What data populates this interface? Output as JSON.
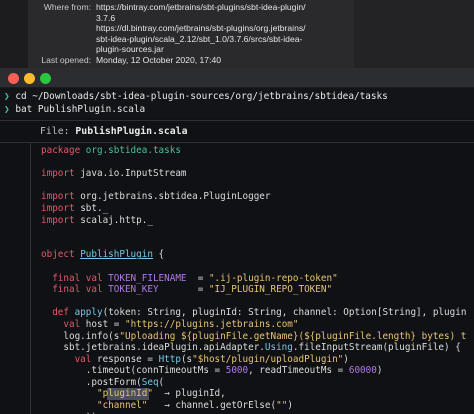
{
  "info_panel": {
    "rows": [
      {
        "key": "Where from:",
        "values": [
          "https://bintray.com/jetbrains/sbt-plugins/sbt-idea-plugin/",
          "3.7.6",
          "https://dl.bintray.com/jetbrains/sbt-plugins/org.jetbrains/",
          "sbt-idea-plugin/scala_2.12/sbt_1.0/3.7.6/srcs/sbt-idea-",
          "plugin-sources.jar"
        ]
      },
      {
        "key": "Last opened:",
        "values": [
          "Monday, 12 October 2020, 17:40"
        ]
      }
    ]
  },
  "terminal": {
    "prompt_symbol": "❯",
    "commands": [
      "cd ~/Downloads/sbt-idea-plugin-sources/org/jetbrains/sbtidea/tasks",
      "bat PublishPlugin.scala"
    ],
    "file_header_label": "File:",
    "file_name": "PublishPlugin.scala"
  },
  "code_lines": [
    [
      {
        "t": "package ",
        "c": "kw"
      },
      {
        "t": "org.sbtidea.tasks",
        "c": "pk"
      }
    ],
    [],
    [
      {
        "t": "import ",
        "c": "kw"
      },
      {
        "t": "java.io.InputStream",
        "c": ""
      }
    ],
    [],
    [
      {
        "t": "import ",
        "c": "kw"
      },
      {
        "t": "org.jetbrains.sbtidea.PluginLogger",
        "c": ""
      }
    ],
    [
      {
        "t": "import ",
        "c": "kw"
      },
      {
        "t": "sbt._",
        "c": ""
      }
    ],
    [
      {
        "t": "import ",
        "c": "kw"
      },
      {
        "t": "scalaj.http._",
        "c": ""
      }
    ],
    [],
    [],
    [
      {
        "t": "object ",
        "c": "kw"
      },
      {
        "t": "PublishPlugin",
        "c": "ty ul"
      },
      {
        "t": " {",
        "c": ""
      }
    ],
    [],
    [
      {
        "t": "  final val ",
        "c": "kw"
      },
      {
        "t": "TOKEN_FILENAME",
        "c": "cst"
      },
      {
        "t": "  = ",
        "c": ""
      },
      {
        "t": "\".ij-plugin-repo-token\"",
        "c": "str"
      }
    ],
    [
      {
        "t": "  final val ",
        "c": "kw"
      },
      {
        "t": "TOKEN_KEY",
        "c": "cst"
      },
      {
        "t": "       = ",
        "c": ""
      },
      {
        "t": "\"IJ_PLUGIN_REPO_TOKEN\"",
        "c": "str"
      }
    ],
    [],
    [
      {
        "t": "  def ",
        "c": "kw"
      },
      {
        "t": "apply",
        "c": "ty"
      },
      {
        "t": "(token: String, pluginId: String, channel: Option[String], plugin",
        "c": ""
      }
    ],
    [
      {
        "t": "    val ",
        "c": "kw"
      },
      {
        "t": "host = ",
        "c": ""
      },
      {
        "t": "\"https://plugins.jetbrains.com\"",
        "c": "str"
      }
    ],
    [
      {
        "t": "    log.info(s",
        "c": ""
      },
      {
        "t": "\"Uploading ${pluginFile.getName}(${pluginFile.length} bytes) t",
        "c": "str"
      }
    ],
    [
      {
        "t": "    sbt.jetbrains.ideaPlugin.apiAdapter.",
        "c": ""
      },
      {
        "t": "Using",
        "c": "ty"
      },
      {
        "t": ".fileInputStream(pluginFile) {",
        "c": ""
      }
    ],
    [
      {
        "t": "      val ",
        "c": "kw"
      },
      {
        "t": "response = ",
        "c": ""
      },
      {
        "t": "Http",
        "c": "ty"
      },
      {
        "t": "(s",
        "c": ""
      },
      {
        "t": "\"$host/plugin/uploadPlugin\"",
        "c": "str"
      },
      {
        "t": ")",
        "c": ""
      }
    ],
    [
      {
        "t": "        .timeout(connTimeoutMs = ",
        "c": ""
      },
      {
        "t": "5000",
        "c": "num-lit"
      },
      {
        "t": ", readTimeoutMs = ",
        "c": ""
      },
      {
        "t": "60000",
        "c": "num-lit"
      },
      {
        "t": ")",
        "c": ""
      }
    ],
    [
      {
        "t": "        .postForm(",
        "c": ""
      },
      {
        "t": "Seq",
        "c": "ty"
      },
      {
        "t": "(",
        "c": ""
      }
    ],
    [
      {
        "t": "          ",
        "c": ""
      },
      {
        "t": "\"pluginId\"",
        "c": "str"
      },
      {
        "t": "  → pluginId,",
        "c": ""
      }
    ],
    [
      {
        "t": "          ",
        "c": ""
      },
      {
        "t": "\"channel\"",
        "c": "str"
      },
      {
        "t": "   → channel.getOrElse(",
        "c": ""
      },
      {
        "t": "\"\"",
        "c": "str"
      },
      {
        "t": ")",
        "c": ""
      }
    ],
    [
      {
        "t": "        ))",
        "c": ""
      }
    ]
  ],
  "highlighted_line_index": 21
}
